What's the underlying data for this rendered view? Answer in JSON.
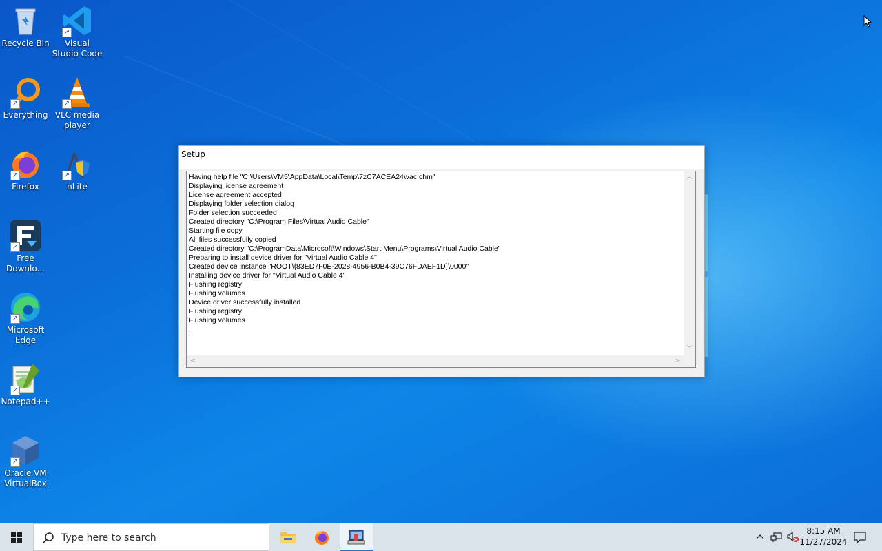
{
  "desktop": {
    "icons": [
      {
        "label": "Recycle Bin"
      },
      {
        "label": "Visual Studio Code"
      },
      {
        "label": "Everything"
      },
      {
        "label": "VLC media player"
      },
      {
        "label": "Firefox"
      },
      {
        "label": "nLite"
      },
      {
        "label": "Free Downlo..."
      },
      {
        "label": "Microsoft Edge"
      },
      {
        "label": "Notepad++"
      },
      {
        "label": "Oracle VM VirtualBox"
      }
    ]
  },
  "setup_window": {
    "title": "Setup",
    "log": "Having help file \"C:\\Users\\VM5\\AppData\\Local\\Temp\\7zC7ACEA24\\vac.chm\"\nDisplaying license agreement\nLicense agreement accepted\nDisplaying folder selection dialog\nFolder selection succeeded\nCreated directory \"C:\\Program Files\\Virtual Audio Cable\"\nStarting file copy\nAll files successfully copied\nCreated directory \"C:\\ProgramData\\Microsoft\\Windows\\Start Menu\\Programs\\Virtual Audio Cable\"\nPreparing to install device driver for \"Virtual Audio Cable 4\"\nCreated device instance \"ROOT\\{83ED7F0E-2028-4956-B0B4-39C76FDAEF1D}\\0000\"\nInstalling device driver for \"Virtual Audio Cable 4\"\nFlushing registry\nFlushing volumes\nDevice driver successfully installed\nFlushing registry\nFlushing volumes\n"
  },
  "taskbar": {
    "search_placeholder": "Type here to search",
    "time": "8:15 AM",
    "date": "11/27/2024"
  },
  "colors": {
    "desktop_blue": "#0b6fd9",
    "taskbar": "#dbe3ea",
    "active_indicator": "#2a6fc9"
  }
}
